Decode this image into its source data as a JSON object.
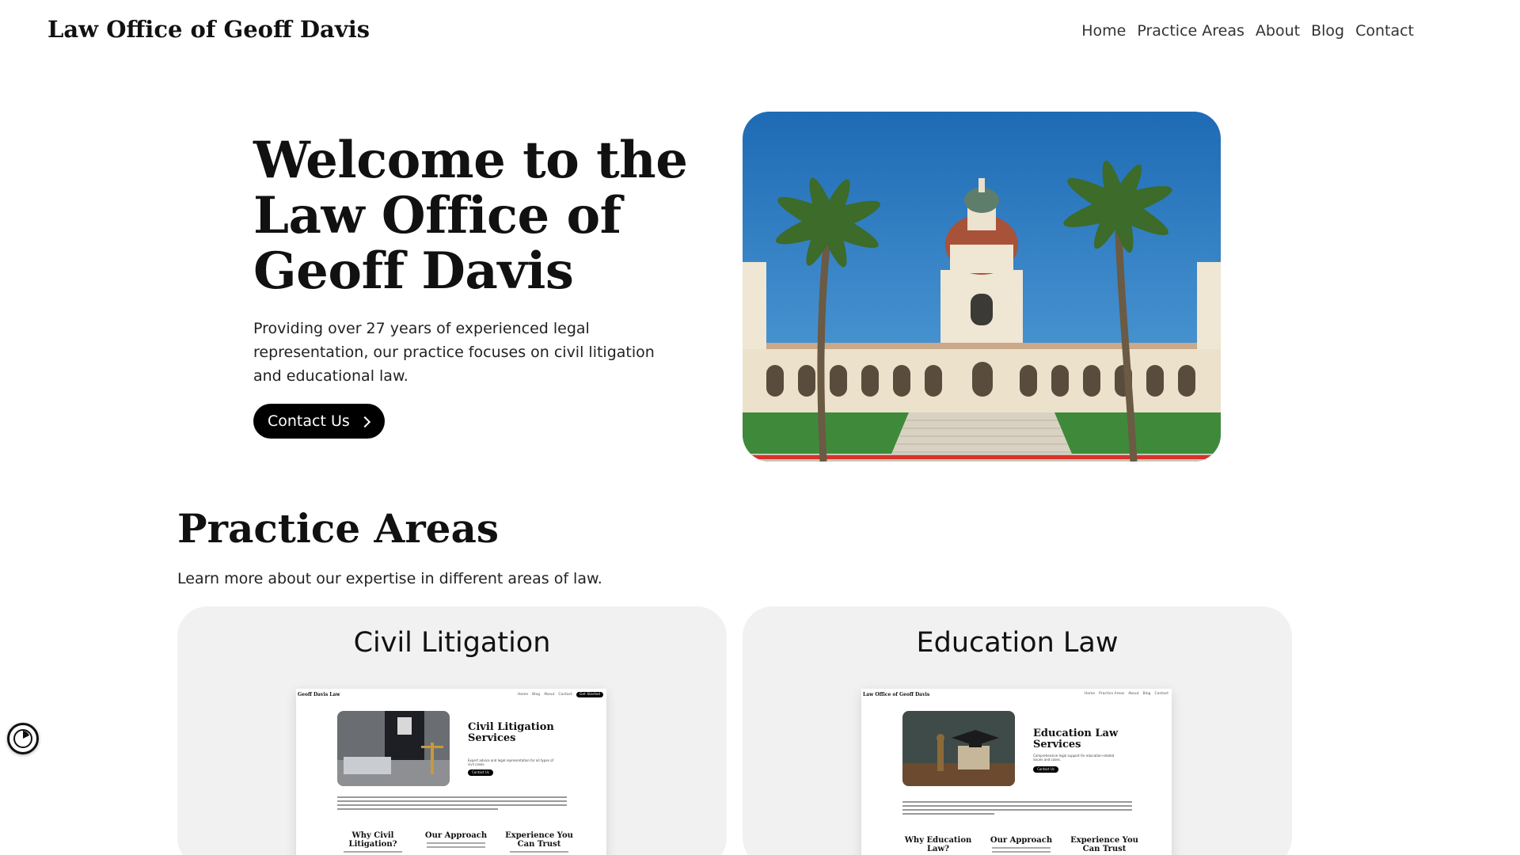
{
  "header": {
    "brand": "Law Office of Geoff Davis",
    "nav": [
      "Home",
      "Practice Areas",
      "About",
      "Blog",
      "Contact"
    ]
  },
  "hero": {
    "title": "Welcome to the Law Office of Geoff Davis",
    "subtitle": "Providing over 27 years of experienced legal representation, our practice focuses on civil litigation and educational law.",
    "cta_label": "Contact Us",
    "image_icon": "city-hall-photo"
  },
  "practice_areas": {
    "title": "Practice Areas",
    "subtitle": "Learn more about our expertise in different areas of law.",
    "cards": [
      {
        "title": "Civil Litigation",
        "preview": {
          "brand": "Geoff Davis Law",
          "nav": [
            "Home",
            "Blog",
            "About",
            "Contact"
          ],
          "nav_pill": "Get Started",
          "heading": "Civil Litigation Services",
          "text": "Expert advice and legal representation for all types of civil cases.",
          "button": "Contact Us",
          "columns": [
            "Why Civil Litigation?",
            "Our Approach",
            "Experience You Can Trust"
          ]
        }
      },
      {
        "title": "Education Law",
        "preview": {
          "brand": "Law Office of Geoff Davis",
          "nav": [
            "Home",
            "Practice Areas",
            "About",
            "Blog",
            "Contact"
          ],
          "heading": "Education Law Services",
          "text": "Comprehensive legal support for education-related issues and cases.",
          "button": "Contact Us",
          "columns": [
            "Why Education Law?",
            "Our Approach",
            "Experience You Can Trust"
          ]
        }
      }
    ]
  },
  "widget": {
    "icon": "clock-icon"
  },
  "colors": {
    "accent": "#000000",
    "card_bg": "#f1f1f1",
    "sky": "#2f7fc4"
  }
}
